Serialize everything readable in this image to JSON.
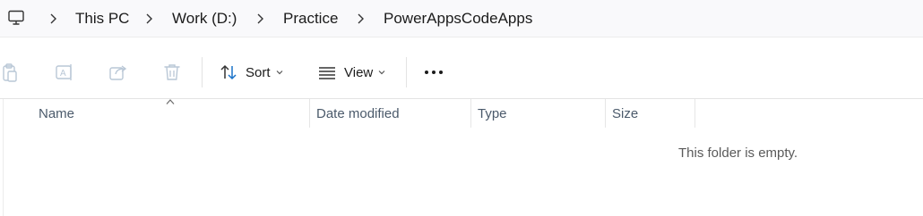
{
  "address": {
    "root_icon": "computer-icon",
    "crumbs": [
      "This PC",
      "Work (D:)",
      "Practice",
      "PowerAppsCodeApps"
    ]
  },
  "toolbar": {
    "icons": {
      "paste": "clipboard-icon",
      "rename": "rename-icon",
      "share": "share-icon",
      "delete": "trash-icon",
      "sort": "sort-arrows-icon",
      "view": "view-lines-icon",
      "more": "more-dots-icon"
    },
    "sort_label": "Sort",
    "view_label": "View"
  },
  "columns": {
    "name": "Name",
    "date_modified": "Date modified",
    "type": "Type",
    "size": "Size"
  },
  "empty_message": "This folder is empty.",
  "colors": {
    "accent": "#1a73c9",
    "disabled_icon": "#b9c7d6",
    "header_text": "#4b5a6b"
  }
}
